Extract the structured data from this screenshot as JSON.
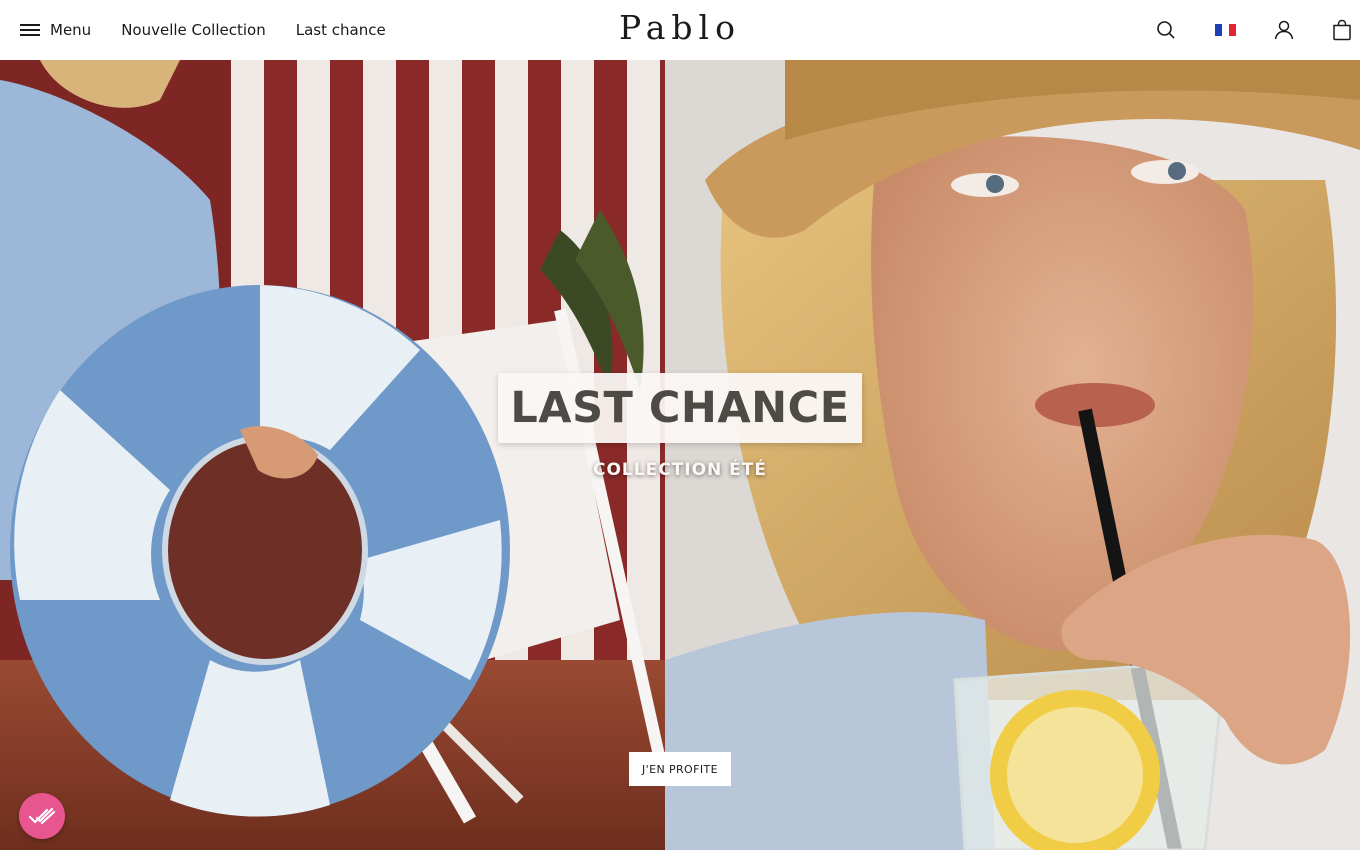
{
  "header": {
    "menu_label": "Menu",
    "nav_links": [
      "Nouvelle Collection",
      "Last chance"
    ],
    "logo": "Pablo",
    "icons": [
      "search-icon",
      "france-flag-icon",
      "account-icon",
      "bag-icon"
    ]
  },
  "hero": {
    "headline": "LAST CHANCE",
    "subline": "COLLECTION ÉTÉ",
    "cta_label": "J'EN PROFITE"
  },
  "badge": {
    "icon": "check-badge-icon",
    "color": "#e8568f"
  },
  "colors": {
    "brand_text": "#1a1a1a",
    "badge": "#e8568f",
    "headline": "#4e4a46"
  }
}
